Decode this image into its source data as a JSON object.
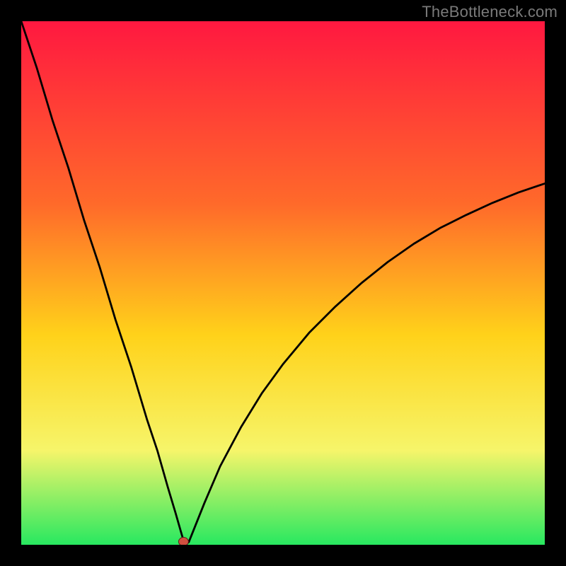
{
  "watermark": "TheBottleneck.com",
  "colors": {
    "bg": "#000000",
    "curve": "#000000",
    "marker_fill": "#d05040",
    "marker_stroke": "#5a1f18",
    "grad_top": "#ff1840",
    "grad_mid1": "#ff6a2a",
    "grad_mid2": "#ffd21a",
    "grad_mid3": "#f6f56a",
    "grad_bottom": "#28e860"
  },
  "chart_data": {
    "type": "line",
    "title": "",
    "xlabel": "",
    "ylabel": "",
    "xlim": [
      0,
      100
    ],
    "ylim": [
      0,
      100
    ],
    "grid": false,
    "legend": false,
    "annotations": [],
    "series": [
      {
        "name": "bottleneck-curve",
        "x": [
          0,
          3,
          6,
          9,
          12,
          15,
          18,
          21,
          24,
          26,
          28,
          29.5,
          30.5,
          31,
          31.5,
          32,
          33,
          35,
          38,
          42,
          46,
          50,
          55,
          60,
          65,
          70,
          75,
          80,
          85,
          90,
          95,
          100
        ],
        "y": [
          100,
          91,
          81,
          72,
          62,
          53,
          43,
          34,
          24,
          18,
          11,
          6,
          2.5,
          0.8,
          0.2,
          0.5,
          3,
          8,
          15,
          22.5,
          29,
          34.5,
          40.5,
          45.5,
          50,
          54,
          57.5,
          60.5,
          63,
          65.3,
          67.3,
          69
        ]
      }
    ],
    "marker": {
      "x": 31,
      "y": 0.6
    }
  }
}
